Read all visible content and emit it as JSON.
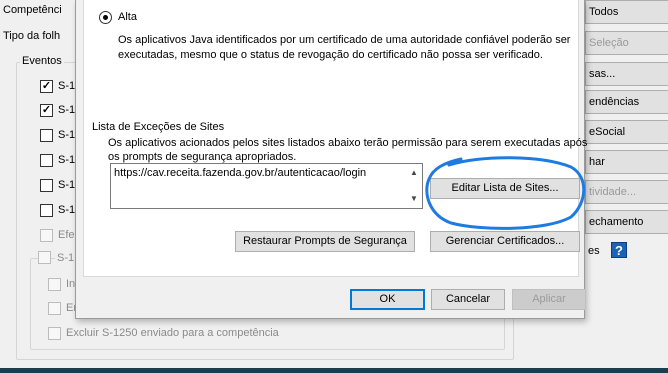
{
  "background_window": {
    "labels": {
      "competencia": "Competênci",
      "tipo_folha": "Tipo da folh"
    },
    "eventos_group_title": "Eventos",
    "checkboxes": [
      {
        "label": "S-1",
        "checked": true,
        "enabled": true
      },
      {
        "label": "S-1",
        "checked": true,
        "enabled": true
      },
      {
        "label": "S-1",
        "checked": false,
        "enabled": true
      },
      {
        "label": "S-1",
        "checked": false,
        "enabled": true
      },
      {
        "label": "S-1",
        "checked": false,
        "enabled": true
      },
      {
        "label": "S-1",
        "checked": false,
        "enabled": true
      },
      {
        "label": "Efe",
        "checked": false,
        "enabled": false
      }
    ],
    "subgroup_title": "S-1",
    "subgroup_checkboxes": [
      {
        "label": "In",
        "checked": false
      },
      {
        "label": "En",
        "checked": false
      },
      {
        "label": "Excluir S-1250 enviado para a competência",
        "checked": false
      }
    ],
    "side_buttons": [
      {
        "label": "Todos",
        "enabled": true
      },
      {
        "label": "Seleção",
        "enabled": false
      },
      {
        "label": "sas...",
        "enabled": true
      },
      {
        "label": "endências",
        "enabled": true
      },
      {
        "label": "eSocial",
        "enabled": true
      },
      {
        "label": "har",
        "enabled": true
      },
      {
        "label": "tividade...",
        "enabled": false
      },
      {
        "label": "echamento",
        "enabled": true
      },
      {
        "label": "es",
        "enabled": true
      }
    ],
    "help_icon": "?"
  },
  "dialog": {
    "radio_alta_label": "Alta",
    "alta_description_line1": "Os aplicativos Java identificados por um certificado de uma autoridade confiável poderão ser",
    "alta_description_line2": "executadas, mesmo que o status de revogação do certificado não possa ser verificado.",
    "exceptions_title": "Lista de Exceções de Sites",
    "exceptions_description_line1": "Os aplicativos acionados pelos sites listados abaixo terão permissão para serem executadas após",
    "exceptions_description_line2": "os prompts de segurança apropriados.",
    "site_list_value": "https://cav.receita.fazenda.gov.br/autenticacao/login",
    "edit_sites_button": "Editar Lista de Sites...",
    "restore_prompts_button": "Restaurar Prompts de Segurança",
    "manage_certs_button": "Gerenciar Certificados...",
    "ok_button": "OK",
    "cancel_button": "Cancelar",
    "apply_button": "Aplicar"
  },
  "colors": {
    "annotation_circle": "#1e7be0",
    "default_button_border": "#0078d7",
    "taskbar": "#1a3e4e"
  },
  "icons": [
    "checkbox-checked-icon",
    "radio-selected-icon",
    "scroll-up-icon",
    "scroll-down-icon",
    "help-icon"
  ]
}
